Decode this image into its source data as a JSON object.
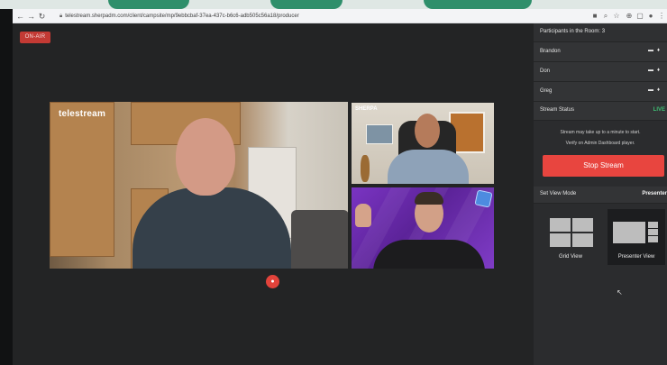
{
  "browser": {
    "url": "telestream.sherpadm.com/client/campsite/mp/9ebbcbaf-37ea-437c-b6c6-adb505c56a18/producer",
    "nav_icons": [
      "back-icon",
      "forward-icon",
      "reload-icon"
    ]
  },
  "stage": {
    "on_air_label": "ON-AIR",
    "main_logo_text": "telestream",
    "tr_logo_text": "SHERPA"
  },
  "sidebar": {
    "participants_label": "Participants in the Room:",
    "participants_count": "3",
    "participants": [
      {
        "name": "Brandon"
      },
      {
        "name": "Don"
      },
      {
        "name": "Greg"
      }
    ],
    "stream_status_label": "Stream Status",
    "stream_status_value": "LIVE",
    "notice_line1": "Stream may take up to a minute to start.",
    "notice_line2": "Verify on Admin Dashboard player.",
    "stop_stream_label": "Stop Stream",
    "view_mode_label": "Set View Mode",
    "view_mode_value": "Presenter",
    "views": [
      {
        "label": "Grid View",
        "selected": false
      },
      {
        "label": "Presenter View",
        "selected": true
      }
    ]
  },
  "colors": {
    "on_air": "#c33a34",
    "stop_stream": "#e8453f",
    "live": "#3fbf74",
    "record": "#e2433b"
  }
}
